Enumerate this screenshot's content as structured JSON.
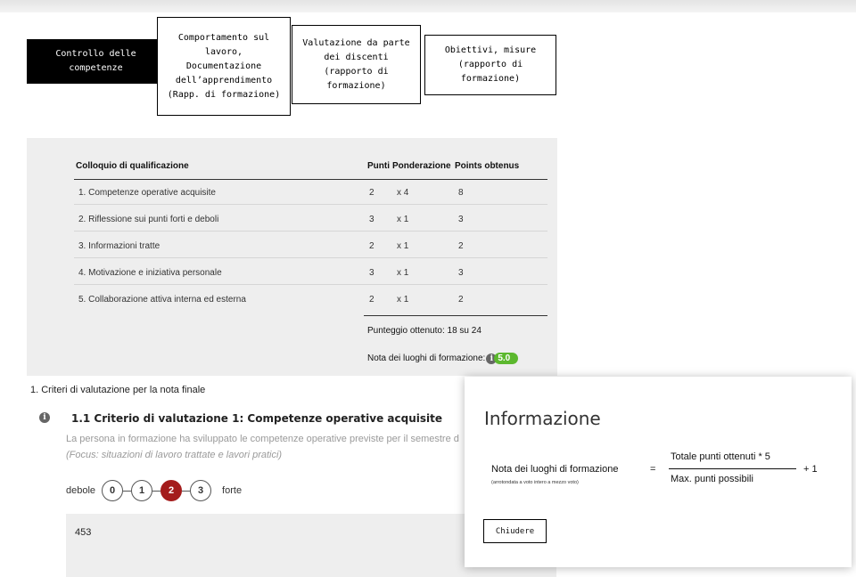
{
  "tabs": [
    {
      "lines": [
        "Controllo delle",
        "competenze"
      ],
      "active": true
    },
    {
      "lines": [
        "Comportamento sul",
        "lavoro,",
        "Documentazione",
        "dell’apprendimento",
        "(Rapp. di formazione)"
      ],
      "active": false
    },
    {
      "lines": [
        "Valutazione da parte",
        "dei discenti",
        "(rapporto di",
        "formazione)"
      ],
      "active": false
    },
    {
      "lines": [
        "Obiettivi, misure",
        "(rapporto di",
        "formazione)"
      ],
      "active": false
    }
  ],
  "table": {
    "headers": {
      "name": "Colloquio di qualificazione",
      "points": "Punti",
      "weight": "Ponderazione",
      "obtained": "Points obtenus"
    },
    "rows": [
      {
        "name": "1. Competenze operative acquisite",
        "points": "2",
        "weight": "x 4",
        "obtained": "8"
      },
      {
        "name": "2. Riflessione sui punti forti e deboli",
        "points": "3",
        "weight": "x 1",
        "obtained": "3"
      },
      {
        "name": "3. Informazioni tratte",
        "points": "2",
        "weight": "x 1",
        "obtained": "2"
      },
      {
        "name": "4. Motivazione e iniziativa personale",
        "points": "3",
        "weight": "x 1",
        "obtained": "3"
      },
      {
        "name": "5. Collaborazione attiva interna ed esterna",
        "points": "2",
        "weight": "x 1",
        "obtained": "2"
      }
    ],
    "total": "Punteggio ottenuto: 18 su 24",
    "note_label": "Nota dei luoghi di formazione:",
    "note_value": "5.0"
  },
  "section": {
    "title": "1. Criteri di valutazione per la nota finale"
  },
  "criterion": {
    "title": "1.1 Criterio di valutazione 1: Competenze operative acquisite",
    "desc": "La persona in formazione ha sviluppato le competenze operative previste per il semestre d",
    "focus": "(Focus: situazioni di lavoro trattate e lavori pratici)",
    "scale_low": "debole",
    "scale_high": "forte",
    "options": [
      "0",
      "1",
      "2",
      "3"
    ],
    "selected": "2",
    "comment": "453"
  },
  "modal": {
    "title": "Informazione",
    "formula_label": "Nota dei luoghi di formazione",
    "formula_sub": "(arrotondata a voto intero a mezzo voto)",
    "equals": "=",
    "numerator": "Totale punti ottenuti * 5",
    "denominator": "Max. punti possibili",
    "plus": "+ 1",
    "close_label": "Chiudere"
  },
  "colors": {
    "accent_selected": "#a41c1c",
    "grade_pill": "#5cb82e",
    "panel_bg": "#eeeeee"
  }
}
